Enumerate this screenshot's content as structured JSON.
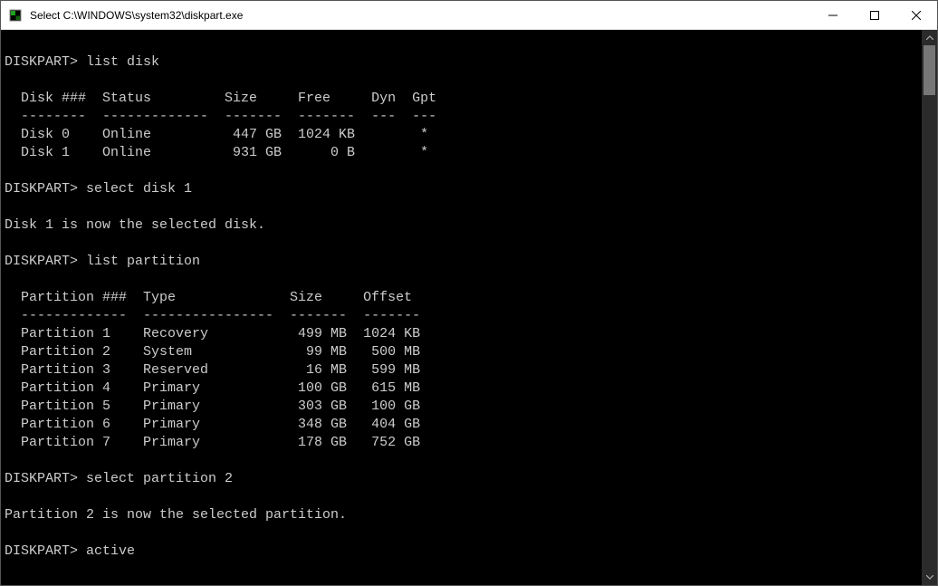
{
  "window": {
    "title": "Select C:\\WINDOWS\\system32\\diskpart.exe"
  },
  "prompt": "DISKPART>",
  "session": {
    "cmd1": "list disk",
    "disk_header": "  Disk ###  Status         Size     Free     Dyn  Gpt",
    "disk_divider": "  --------  -------------  -------  -------  ---  ---",
    "disks": [
      "  Disk 0    Online          447 GB  1024 KB        *",
      "  Disk 1    Online          931 GB      0 B        *"
    ],
    "cmd2": "select disk 1",
    "resp2": "Disk 1 is now the selected disk.",
    "cmd3": "list partition",
    "part_header": "  Partition ###  Type              Size     Offset",
    "part_divider": "  -------------  ----------------  -------  -------",
    "partitions": [
      "  Partition 1    Recovery           499 MB  1024 KB",
      "  Partition 2    System              99 MB   500 MB",
      "  Partition 3    Reserved            16 MB   599 MB",
      "  Partition 4    Primary            100 GB   615 MB",
      "  Partition 5    Primary            303 GB   100 GB",
      "  Partition 6    Primary            348 GB   404 GB",
      "  Partition 7    Primary            178 GB   752 GB"
    ],
    "cmd4": "select partition 2",
    "resp4": "Partition 2 is now the selected partition.",
    "cmd5": "active"
  },
  "chart_data": {
    "type": "table",
    "tables": [
      {
        "title": "list disk",
        "columns": [
          "Disk ###",
          "Status",
          "Size",
          "Free",
          "Dyn",
          "Gpt"
        ],
        "rows": [
          [
            "Disk 0",
            "Online",
            "447 GB",
            "1024 KB",
            "",
            "*"
          ],
          [
            "Disk 1",
            "Online",
            "931 GB",
            "0 B",
            "",
            "*"
          ]
        ]
      },
      {
        "title": "list partition",
        "columns": [
          "Partition ###",
          "Type",
          "Size",
          "Offset"
        ],
        "rows": [
          [
            "Partition 1",
            "Recovery",
            "499 MB",
            "1024 KB"
          ],
          [
            "Partition 2",
            "System",
            "99 MB",
            "500 MB"
          ],
          [
            "Partition 3",
            "Reserved",
            "16 MB",
            "599 MB"
          ],
          [
            "Partition 4",
            "Primary",
            "100 GB",
            "615 MB"
          ],
          [
            "Partition 5",
            "Primary",
            "303 GB",
            "100 GB"
          ],
          [
            "Partition 6",
            "Primary",
            "348 GB",
            "404 GB"
          ],
          [
            "Partition 7",
            "Primary",
            "178 GB",
            "752 GB"
          ]
        ]
      }
    ]
  }
}
